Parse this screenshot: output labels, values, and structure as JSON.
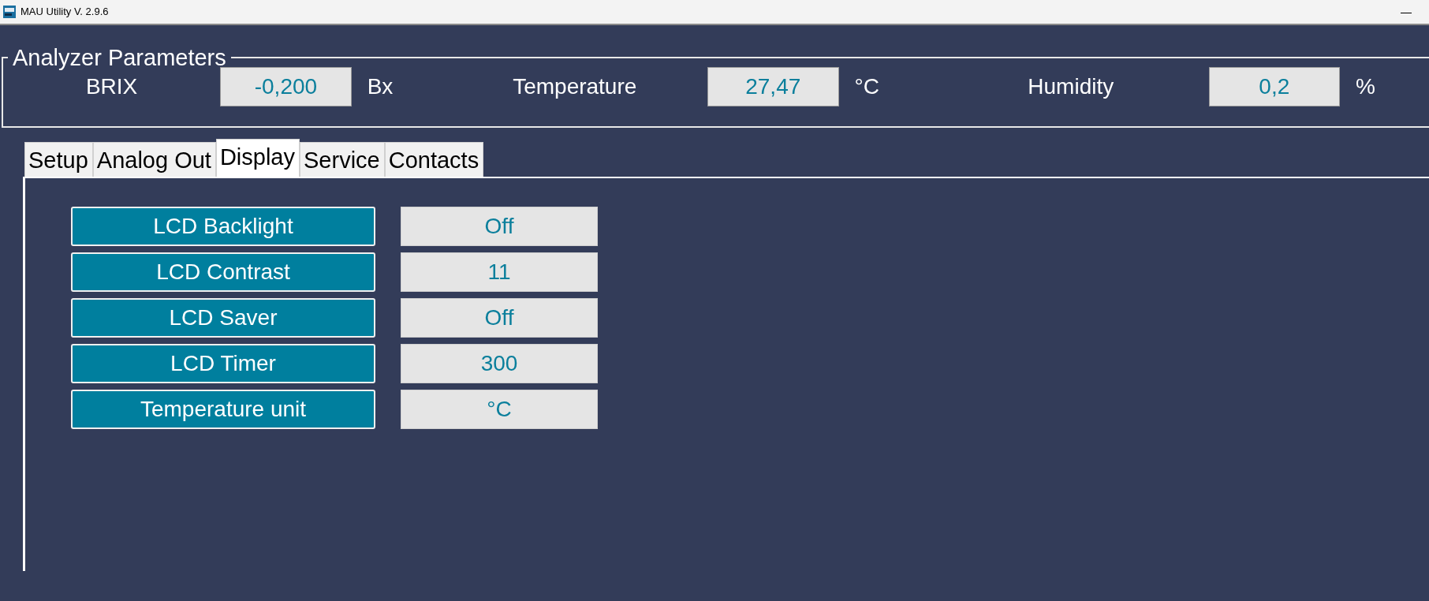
{
  "window": {
    "title": "MAU Utility V. 2.9.6",
    "minimize": "—"
  },
  "analyzer": {
    "title": "Analyzer Parameters",
    "readings": [
      {
        "label": "BRIX",
        "value": "-0,200",
        "unit": "Bx"
      },
      {
        "label": "Temperature",
        "value": "27,47",
        "unit": "°C"
      },
      {
        "label": "Humidity",
        "value": "0,2",
        "unit": "%"
      }
    ]
  },
  "tabs": [
    {
      "label": "Setup",
      "selected": false
    },
    {
      "label": "Analog Out",
      "selected": false
    },
    {
      "label": "Display",
      "selected": true
    },
    {
      "label": "Service",
      "selected": false
    },
    {
      "label": "Contacts",
      "selected": false
    }
  ],
  "settings": [
    {
      "label": "LCD Backlight",
      "value": "Off"
    },
    {
      "label": "LCD Contrast",
      "value": "11"
    },
    {
      "label": "LCD Saver",
      "value": "Off"
    },
    {
      "label": "LCD Timer",
      "value": "300"
    },
    {
      "label": "Temperature unit",
      "value": "°C"
    }
  ]
}
